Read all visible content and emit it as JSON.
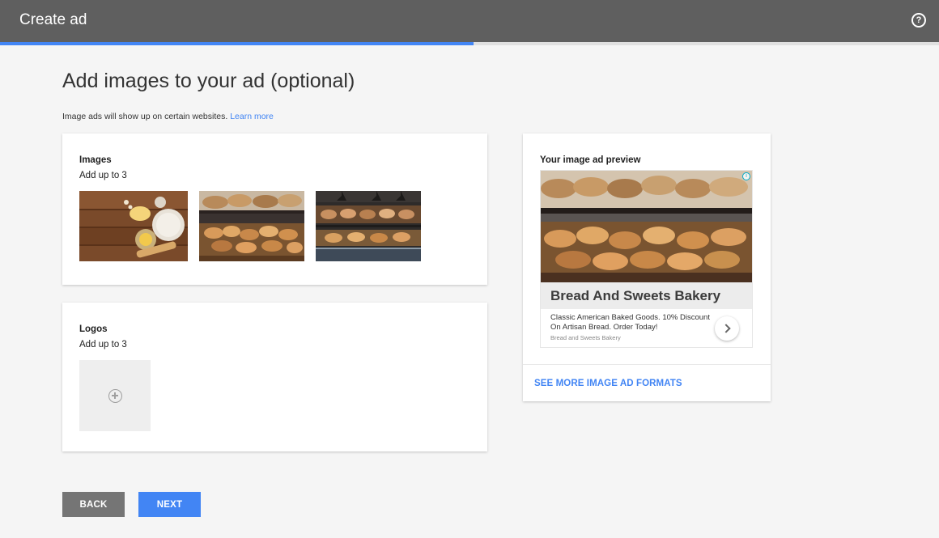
{
  "topbar": {
    "title": "Create ad",
    "help_icon": "help-circle-icon"
  },
  "progress": {
    "fraction": 0.504,
    "color": "#4285f4"
  },
  "page": {
    "title": "Add images to your ad (optional)",
    "subtitle": "Image ads will show up on certain websites. ",
    "learn_more": "Learn more"
  },
  "images_card": {
    "heading": "Images",
    "sub": "Add up to 3",
    "thumbnails": [
      "baking-ingredients-photo",
      "bread-display-photo",
      "bakery-interior-photo"
    ]
  },
  "logos_card": {
    "heading": "Logos",
    "sub": "Add up to 3",
    "add_icon": "add-circle-icon"
  },
  "preview_card": {
    "heading": "Your image ad preview",
    "ad": {
      "headline": "Bread And Sweets Bakery",
      "description": "Classic American Baked Goods. 10% Discount On Artisan Bread. Order Today!",
      "display_name": "Bread and Sweets Bakery",
      "info_icon": "i"
    },
    "more_formats": "SEE MORE IMAGE AD FORMATS"
  },
  "buttons": {
    "back": "BACK",
    "next": "NEXT"
  },
  "colors": {
    "topbar": "#5f5f5f",
    "accent": "#4285f4",
    "back_button": "#757575"
  }
}
